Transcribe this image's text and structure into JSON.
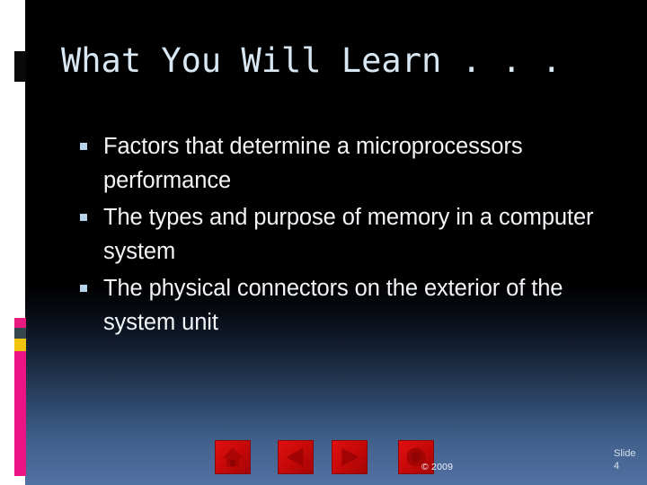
{
  "slide": {
    "title": "What You Will Learn . . .",
    "bullets": [
      "Factors that determine a microprocessors performance",
      "The types and purpose of memory in a computer system",
      "The physical connectors on the exterior of the system unit"
    ],
    "copyright": "© 2009",
    "slide_number": "Slide 4",
    "nav": {
      "home_label": "home-button",
      "back_label": "previous-slide-button",
      "forward_label": "next-slide-button",
      "doc_label": "document-button"
    },
    "colors": {
      "background_top": "#000000",
      "background_bottom": "#5271a3",
      "title_text": "#d9e7f2",
      "body_text": "#f2f4f7",
      "bullet_marker": "#b8d4ea",
      "strip_white": "#ffffff",
      "strip_block": "#0a0a0a",
      "strip_magenta": "#ec1485",
      "strip_teal": "#33474d",
      "strip_gold": "#f2c40d",
      "nav_button_red": "#c40808"
    }
  }
}
